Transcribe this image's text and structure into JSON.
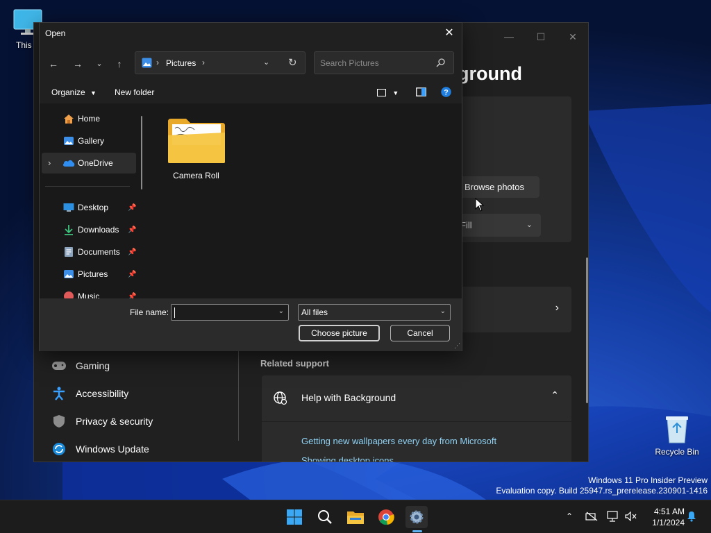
{
  "desktop": {
    "icons": [
      {
        "label": "This P",
        "icon": "monitor-icon"
      },
      {
        "label": "Recycle Bin",
        "icon": "recycle-bin-icon"
      }
    ],
    "watermark": {
      "line1": "Windows 11 Pro Insider Preview",
      "line2": "Evaluation copy. Build 25947.rs_prerelease.230901-1416"
    }
  },
  "settings_window": {
    "heading_visible": "ground",
    "browse_button": "Browse photos",
    "fit_dropdown_value": "Fill",
    "nav_items": [
      {
        "label": "Gaming",
        "icon": "gaming-controller-icon"
      },
      {
        "label": "Accessibility",
        "icon": "accessibility-icon"
      },
      {
        "label": "Privacy & security",
        "icon": "shield-icon"
      },
      {
        "label": "Windows Update",
        "icon": "windows-update-icon"
      }
    ],
    "related_support": "Related support",
    "help_title": "Help with Background",
    "help_links": [
      "Getting new wallpapers every day from Microsoft",
      "Showing desktop icons"
    ]
  },
  "dialog": {
    "title": "Open",
    "breadcrumb": "Pictures",
    "search_placeholder": "Search Pictures",
    "organize": "Organize",
    "new_folder": "New folder",
    "tree": [
      {
        "label": "Home",
        "icon": "home-icon",
        "pinned": false
      },
      {
        "label": "Gallery",
        "icon": "gallery-icon",
        "pinned": false
      },
      {
        "label": "OneDrive",
        "icon": "onedrive-icon",
        "pinned": false,
        "selected": true
      },
      {
        "label": "Desktop",
        "icon": "desktop-icon",
        "pinned": true
      },
      {
        "label": "Downloads",
        "icon": "downloads-icon",
        "pinned": true
      },
      {
        "label": "Documents",
        "icon": "documents-icon",
        "pinned": true
      },
      {
        "label": "Pictures",
        "icon": "pictures-icon",
        "pinned": true
      },
      {
        "label": "Music",
        "icon": "music-icon",
        "pinned": true
      }
    ],
    "folders": [
      {
        "label": "Camera Roll",
        "icon": "folder-icon"
      }
    ],
    "file_name_label": "File name:",
    "file_name_value": "",
    "file_type": "All files",
    "choose_button": "Choose picture",
    "cancel_button": "Cancel"
  },
  "taskbar": {
    "apps": [
      {
        "name": "start",
        "icon": "windows-start-icon"
      },
      {
        "name": "search",
        "icon": "search-icon"
      },
      {
        "name": "file-explorer",
        "icon": "file-explorer-icon"
      },
      {
        "name": "chrome",
        "icon": "chrome-icon"
      },
      {
        "name": "settings",
        "icon": "settings-gear-icon",
        "active": true
      }
    ],
    "time": "4:51 AM",
    "date": "1/1/2024"
  },
  "colors": {
    "accent": "#5fb2f2",
    "link": "#8fd3f5",
    "folder": "#f5c542"
  }
}
